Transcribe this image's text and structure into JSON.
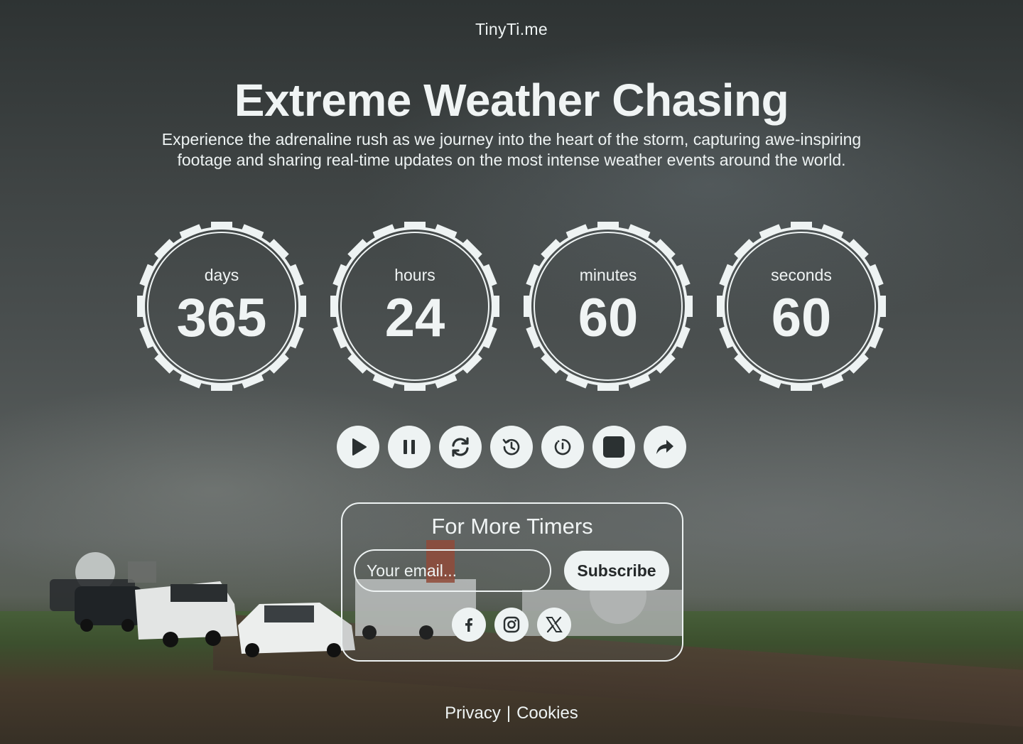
{
  "brand": "TinyTi.me",
  "hero": {
    "title": "Extreme Weather Chasing",
    "subtitle": "Experience the adrenaline rush as we journey into the heart of the storm, capturing awe-inspiring footage and sharing real-time updates on the most intense weather events around the world."
  },
  "counters": [
    {
      "label": "days",
      "value": "365"
    },
    {
      "label": "hours",
      "value": "24"
    },
    {
      "label": "minutes",
      "value": "60"
    },
    {
      "label": "seconds",
      "value": "60"
    }
  ],
  "controls": [
    {
      "name": "play-icon"
    },
    {
      "name": "pause-icon"
    },
    {
      "name": "refresh-icon"
    },
    {
      "name": "history-icon"
    },
    {
      "name": "timer-icon"
    },
    {
      "name": "stop-icon"
    },
    {
      "name": "share-icon"
    }
  ],
  "subscribe": {
    "title": "For More Timers",
    "email_placeholder": "Your email...",
    "button_label": "Subscribe"
  },
  "socials": [
    {
      "name": "facebook-icon"
    },
    {
      "name": "instagram-icon"
    },
    {
      "name": "x-icon"
    }
  ],
  "footer": {
    "privacy": "Privacy",
    "separator": "|",
    "cookies": "Cookies"
  },
  "colors": {
    "foreground": "#eef3f3",
    "button_icon": "#2b3132"
  }
}
